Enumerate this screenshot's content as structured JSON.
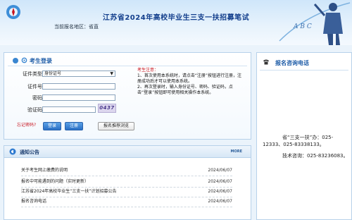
{
  "header": {
    "title": "江苏省2024年高校毕业生三支一扶招募笔试",
    "region": "当前报名地区：省直"
  },
  "login": {
    "title": "考生登录",
    "id_type_label": "证件类型",
    "id_type_value": "身份证号",
    "id_number_label": "证件号",
    "password_label": "密码",
    "captcha_label": "验证码",
    "captcha_code": "0437",
    "login_button": "登录",
    "register_button": "注册",
    "browser_button": "报名推荐浏览",
    "forgot_password": "忘记密码?"
  },
  "notes": {
    "title": "考生注意：",
    "items": [
      "1、首次使用本系统时，请点击“注册”按钮进行注册，注册成功后才可以使用本系统。",
      "2、再次登录时，输入身份证号、密码、验证码，点击“登录”按钮即可使用相关操作本系统。"
    ]
  },
  "contact": {
    "title": "报名咨询电话",
    "line1": "省“三支一扶”办：025-12333、025-83338133。",
    "line2": "技术咨询：025-83236083。"
  },
  "notice": {
    "title": "通知公告",
    "more": "MORE",
    "items": [
      {
        "title": "关于考生网上缴费的说明",
        "date": "2024/06/07"
      },
      {
        "title": "报名中可能遇到的问题（实时更新）",
        "date": "2024/06/07"
      },
      {
        "title": "江苏省2024年高校毕业生“三支一扶”计划招募公告",
        "date": "2024/06/07"
      },
      {
        "title": "报名咨询电话",
        "date": "2024/06/07"
      }
    ]
  }
}
